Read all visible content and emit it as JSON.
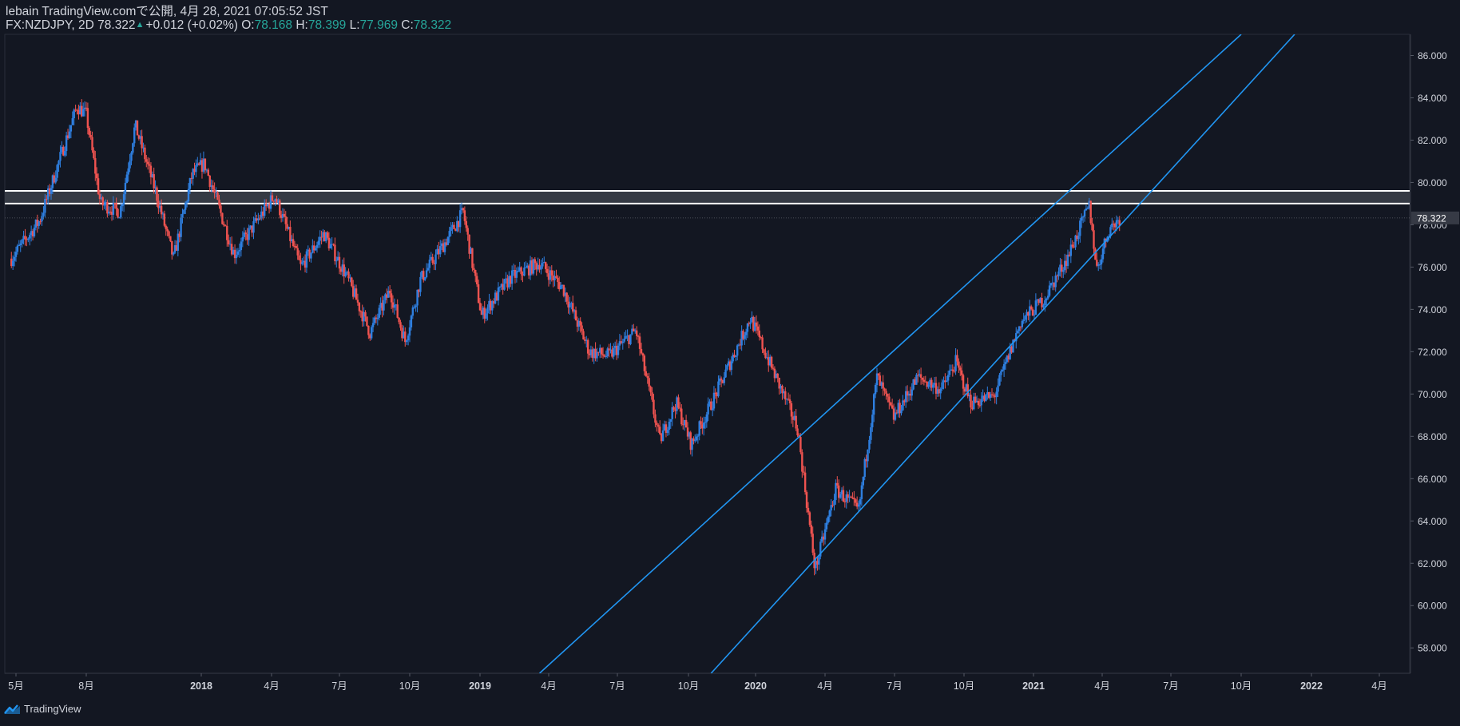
{
  "header": {
    "publish_line": "lebain TradingView.comで公開, 4月 28, 2021 07:05:52 JST",
    "symbol": "FX:NZDJPY, 2D",
    "last": "78.322",
    "change": "+0.012 (+0.02%)",
    "o_label": "O:",
    "o_value": "78.168",
    "h_label": "H:",
    "h_value": "78.399",
    "l_label": "L:",
    "l_value": "77.969",
    "c_label": "C:",
    "c_value": "78.322"
  },
  "footer": {
    "brand": "TradingView"
  },
  "colors": {
    "background": "#131722",
    "up": "#2e7fe0",
    "down": "#ef5350",
    "trendline": "#2196f3",
    "zone_border": "#ffffff",
    "zone_fill": "#3a3e48",
    "axis_text": "#d1d4dc",
    "price_tag_bg": "#363a45"
  },
  "chart_data": {
    "type": "candlestick",
    "symbol": "FX:NZDJPY",
    "timeframe": "2D",
    "ylim": [
      56.8,
      87.0
    ],
    "y_ticks": [
      58,
      60,
      62,
      64,
      66,
      68,
      70,
      72,
      74,
      76,
      78,
      80,
      82,
      84,
      86
    ],
    "y_tick_labels": [
      "58.000",
      "60.000",
      "62.000",
      "64.000",
      "66.000",
      "68.000",
      "70.000",
      "72.000",
      "74.000",
      "76.000",
      "78.000",
      "80.000",
      "82.000",
      "84.000",
      "86.000"
    ],
    "last_price_label": "78.322",
    "x_ticks": [
      "2017-05-01",
      "2017-08-01",
      "2018-01-01",
      "2018-04-01",
      "2018-07-01",
      "2018-10-01",
      "2019-01-01",
      "2019-04-01",
      "2019-07-01",
      "2019-10-01",
      "2020-01-01",
      "2020-04-01",
      "2020-07-01",
      "2020-10-01",
      "2021-01-01",
      "2021-04-01",
      "2021-07-01",
      "2021-10-01",
      "2022-01-01",
      "2022-04-01"
    ],
    "x_tick_labels": [
      "5月",
      "8月",
      "2018",
      "4月",
      "7月",
      "10月",
      "2019",
      "4月",
      "7月",
      "10月",
      "2020",
      "4月",
      "7月",
      "10月",
      "2021",
      "4月",
      "7月",
      "10月",
      "2022",
      "4月"
    ],
    "price_path": [
      [
        "2017-04-25",
        76.4
      ],
      [
        "2017-06-01",
        78.2
      ],
      [
        "2017-07-20",
        83.6
      ],
      [
        "2017-08-01",
        83.2
      ],
      [
        "2017-08-20",
        79.0
      ],
      [
        "2017-09-15",
        78.6
      ],
      [
        "2017-10-05",
        82.7
      ],
      [
        "2017-11-01",
        79.6
      ],
      [
        "2017-11-25",
        76.4
      ],
      [
        "2017-12-20",
        80.4
      ],
      [
        "2018-01-05",
        80.9
      ],
      [
        "2018-02-12",
        76.6
      ],
      [
        "2018-04-05",
        79.4
      ],
      [
        "2018-05-10",
        76.0
      ],
      [
        "2018-06-10",
        77.6
      ],
      [
        "2018-07-10",
        75.6
      ],
      [
        "2018-08-10",
        72.9
      ],
      [
        "2018-09-05",
        74.9
      ],
      [
        "2018-09-25",
        72.5
      ],
      [
        "2018-10-15",
        75.4
      ],
      [
        "2018-11-15",
        77.1
      ],
      [
        "2018-12-10",
        78.6
      ],
      [
        "2019-01-03",
        73.7
      ],
      [
        "2019-02-10",
        75.5
      ],
      [
        "2019-03-20",
        76.2
      ],
      [
        "2019-04-20",
        75.0
      ],
      [
        "2019-05-25",
        72.0
      ],
      [
        "2019-06-20",
        71.8
      ],
      [
        "2019-07-25",
        73.0
      ],
      [
        "2019-08-25",
        67.8
      ],
      [
        "2019-09-15",
        69.6
      ],
      [
        "2019-10-05",
        67.6
      ],
      [
        "2019-11-05",
        69.8
      ],
      [
        "2019-12-25",
        73.6
      ],
      [
        "2020-01-25",
        71.0
      ],
      [
        "2020-02-25",
        68.4
      ],
      [
        "2020-03-19",
        61.7
      ],
      [
        "2020-04-15",
        65.5
      ],
      [
        "2020-05-15",
        64.5
      ],
      [
        "2020-06-08",
        70.8
      ],
      [
        "2020-06-30",
        68.9
      ],
      [
        "2020-08-01",
        70.8
      ],
      [
        "2020-09-01",
        70.2
      ],
      [
        "2020-09-20",
        71.5
      ],
      [
        "2020-10-10",
        69.6
      ],
      [
        "2020-11-10",
        69.9
      ],
      [
        "2020-12-15",
        73.4
      ],
      [
        "2021-01-15",
        74.5
      ],
      [
        "2021-02-15",
        76.5
      ],
      [
        "2021-03-15",
        78.9
      ],
      [
        "2021-03-25",
        75.9
      ],
      [
        "2021-04-10",
        77.8
      ],
      [
        "2021-04-25",
        78.32
      ]
    ],
    "overlays": {
      "resistance_zone": [
        79.0,
        79.6
      ],
      "channel_upper": [
        [
          "2019-03-20",
          56.8
        ],
        [
          "2021-10-01",
          87.0
        ]
      ],
      "channel_lower": [
        [
          "2019-11-01",
          56.8
        ],
        [
          "2021-12-10",
          87.0
        ]
      ]
    }
  }
}
